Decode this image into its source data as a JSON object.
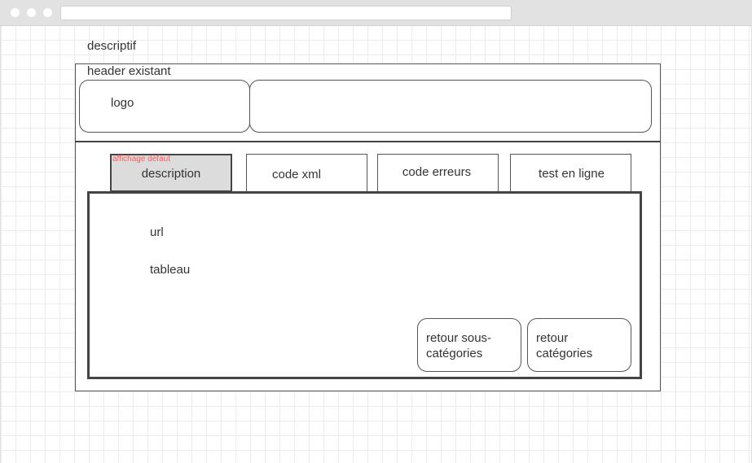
{
  "page": {
    "title": "descriptif",
    "header_label": "header existant",
    "logo_label": "logo"
  },
  "tabs": {
    "default_note": "affichage défaut",
    "items": [
      {
        "label": "description",
        "active": true
      },
      {
        "label": "code xml",
        "active": false
      },
      {
        "label": "code erreurs",
        "active": false
      },
      {
        "label": "test en ligne",
        "active": false
      }
    ]
  },
  "content": {
    "url_label": "url",
    "table_label": "tableau"
  },
  "buttons": {
    "back_subcategories": "retour sous-catégories",
    "back_categories": "retour catégories"
  }
}
